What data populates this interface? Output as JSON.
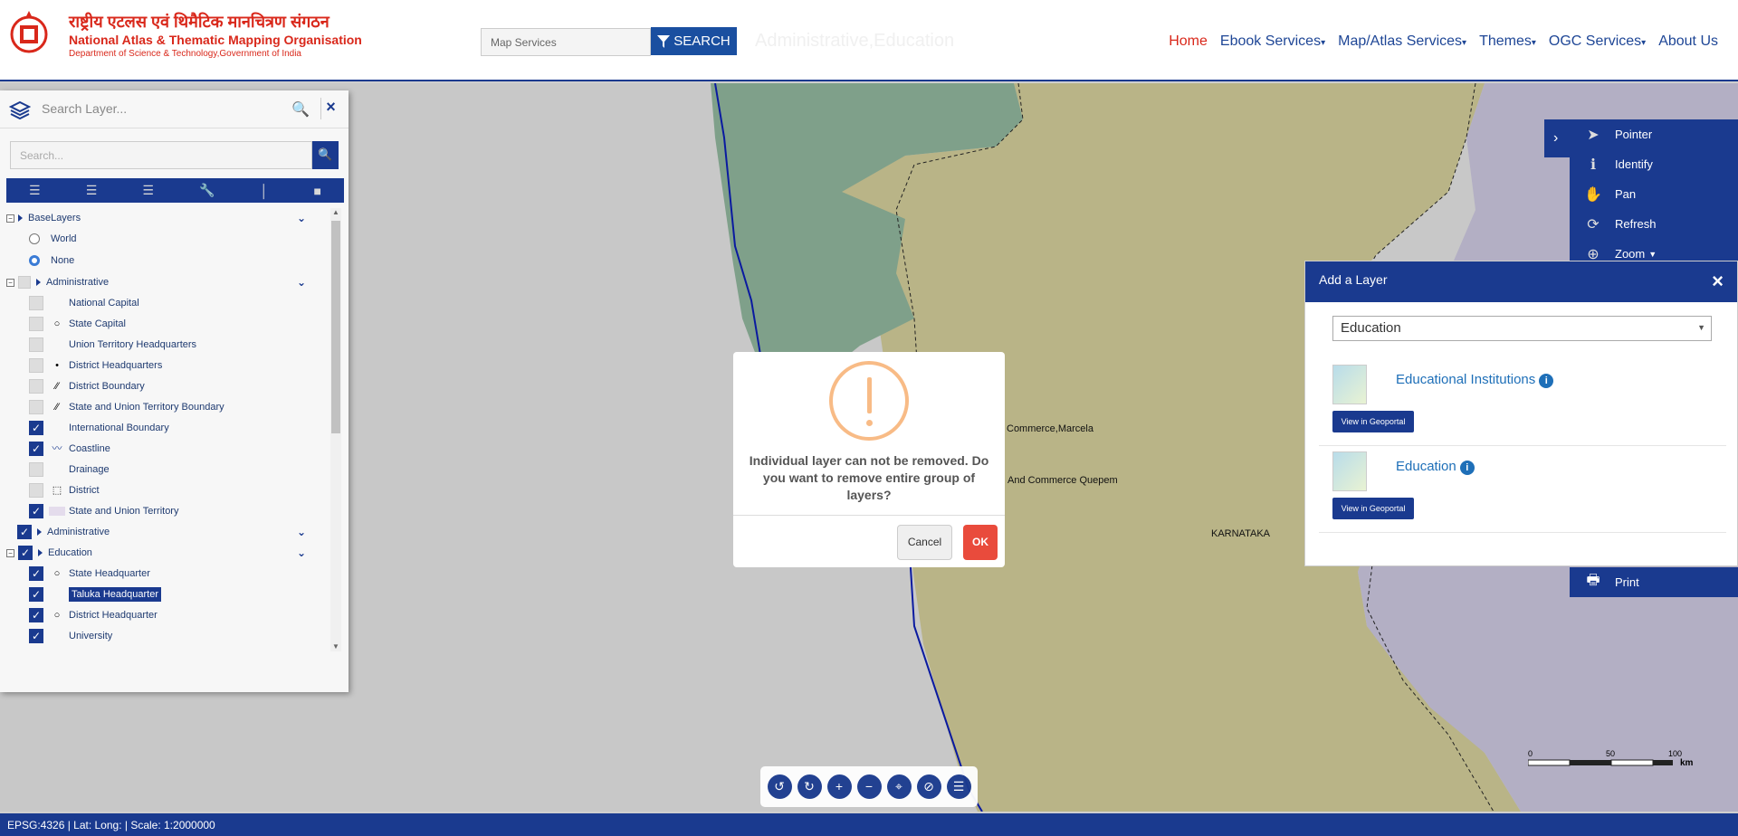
{
  "header": {
    "org_hindi": "राष्ट्रीय एटलस एवं थिमैटिक मानचित्रण संगठन",
    "org_english": "National Atlas & Thematic Mapping Organisation",
    "department": "Department of Science & Technology,Government of India",
    "search_placeholder": "Map Services",
    "search_button": "SEARCH",
    "page_heading": "Administrative,Education"
  },
  "nav": {
    "items": [
      "Home",
      "Ebook Services",
      "Map/Atlas Services",
      "Themes",
      "OGC Services",
      "About Us"
    ],
    "active": "Home"
  },
  "left_panel": {
    "search_layer_placeholder": "Search Layer...",
    "search_placeholder": "Search...",
    "tree": [
      {
        "label": "BaseLayers"
      },
      {
        "label": "World"
      },
      {
        "label": "None"
      },
      {
        "label": "Administrative"
      },
      {
        "label": "National Capital"
      },
      {
        "label": "State Capital"
      },
      {
        "label": "Union Territory Headquarters"
      },
      {
        "label": "District Headquarters"
      },
      {
        "label": "District Boundary"
      },
      {
        "label": "State and Union Territory Boundary"
      },
      {
        "label": "International Boundary"
      },
      {
        "label": "Coastline"
      },
      {
        "label": "Drainage"
      },
      {
        "label": "District"
      },
      {
        "label": "State and Union Territory"
      },
      {
        "label": "Administrative"
      },
      {
        "label": "Education"
      },
      {
        "label": "State Headquarter"
      },
      {
        "label": "Taluka Headquarter"
      },
      {
        "label": "District Headquarter"
      },
      {
        "label": "University"
      }
    ]
  },
  "tools": {
    "items": [
      "Pointer",
      "Identify",
      "Pan",
      "Refresh",
      "Zoom"
    ],
    "print": "Print"
  },
  "add_layer": {
    "title": "Add a Layer",
    "selected_theme": "Education",
    "results": [
      {
        "name": "Educational Institutions",
        "button": "View in Geoportal"
      },
      {
        "name": "Education",
        "button": "View in Geoportal"
      }
    ]
  },
  "dialog": {
    "message": "Individual layer can not be removed. Do you want to remove entire group of layers?",
    "cancel": "Cancel",
    "ok": "OK"
  },
  "map_labels": {
    "label1": "Commerce,Marcela",
    "label2": "And Commerce Quepem",
    "label3": "KARNATAKA"
  },
  "scalebar": {
    "t0": "0",
    "t1": "50",
    "t2": "100",
    "unit": "km"
  },
  "status": "EPSG:4326 | Lat: Long: | Scale: 1:2000000",
  "colors": {
    "primary": "#1a3a8f",
    "accent_red": "#d9281b",
    "warning": "#f8bb86",
    "ok_button": "#e94b3c"
  }
}
